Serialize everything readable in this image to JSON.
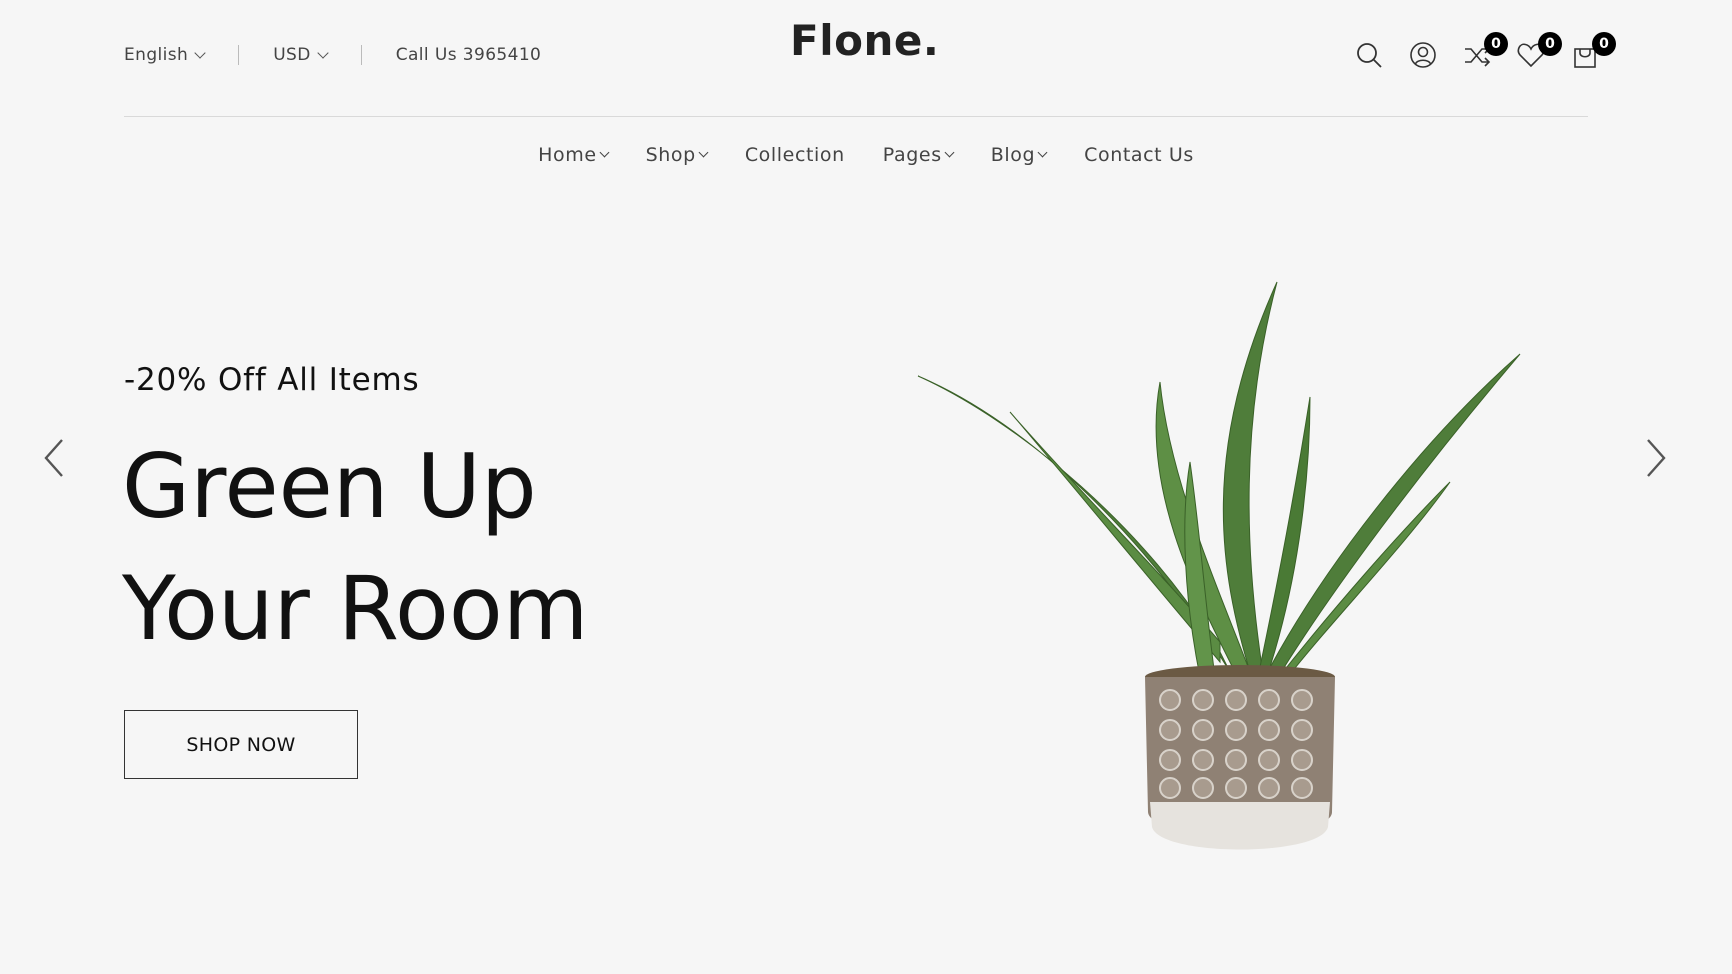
{
  "header": {
    "language": "English",
    "currency": "USD",
    "phone": "Call Us 3965410",
    "logo": "Flone.",
    "compare_count": "0",
    "wishlist_count": "0",
    "cart_count": "0"
  },
  "nav": {
    "items": [
      {
        "label": "Home",
        "dropdown": true
      },
      {
        "label": "Shop",
        "dropdown": true
      },
      {
        "label": "Collection",
        "dropdown": false
      },
      {
        "label": "Pages",
        "dropdown": true
      },
      {
        "label": "Blog",
        "dropdown": true
      },
      {
        "label": "Contact Us",
        "dropdown": false
      }
    ]
  },
  "hero": {
    "subtitle": "-20% Off All Items",
    "title_line1": "Green Up",
    "title_line2": "Your Room",
    "cta": "SHOP NOW"
  },
  "icons": {
    "search": "search-icon",
    "account": "user-icon",
    "compare": "shuffle-icon",
    "wishlist": "heart-icon",
    "cart": "shopping-bag-icon",
    "prev": "chevron-left-icon",
    "next": "chevron-right-icon"
  },
  "colors": {
    "background": "#f6f6f6",
    "badge": "#000000",
    "text": "#111111"
  }
}
